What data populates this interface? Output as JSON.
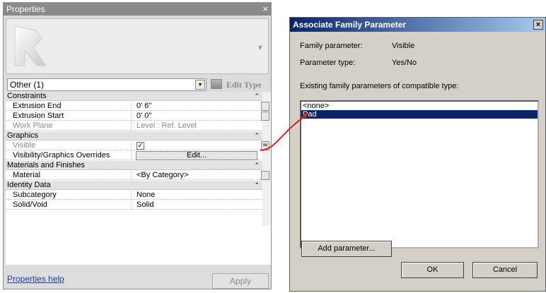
{
  "properties": {
    "title": "Properties",
    "close_glyph": "×",
    "type_selector": "Other (1)",
    "edit_type_label": "Edit Type",
    "groups": {
      "constraints": "Constraints",
      "graphics": "Graphics",
      "materials": "Materials and Finishes",
      "identity": "Identity Data"
    },
    "rows": {
      "extrusion_end": {
        "name": "Extrusion End",
        "value": "0'  6\""
      },
      "extrusion_start": {
        "name": "Extrusion Start",
        "value": "0'  0\""
      },
      "work_plane": {
        "name": "Work Plane",
        "value": "Level : Ref. Level"
      },
      "visible": {
        "name": "Visible",
        "value": "☑"
      },
      "vis_overrides": {
        "name": "Visibility/Graphics Overrides",
        "value": "Edit..."
      },
      "material": {
        "name": "Material",
        "value": "<By Category>"
      },
      "subcategory": {
        "name": "Subcategory",
        "value": "None"
      },
      "solid_void": {
        "name": "Solid/Void",
        "value": "Solid"
      }
    },
    "collapse_glyph": "⌃",
    "param_button_glyph": "=",
    "help_link": "Properties help",
    "apply_button": "Apply"
  },
  "dialog": {
    "title": "Associate Family Parameter",
    "close_glyph": "×",
    "family_parameter_label": "Family parameter:",
    "family_parameter_value": "Visible",
    "parameter_type_label": "Parameter type:",
    "parameter_type_value": "Yes/No",
    "existing_label": "Existing family parameters of compatible type:",
    "list_items": [
      "<none>",
      "Pad"
    ],
    "selected_index": 1,
    "add_parameter_button": "Add parameter...",
    "ok_button": "OK",
    "cancel_button": "Cancel"
  },
  "colors": {
    "accent_arrow": "#e11d1d",
    "selection": "#0a246a",
    "link": "#1f3ea8"
  }
}
